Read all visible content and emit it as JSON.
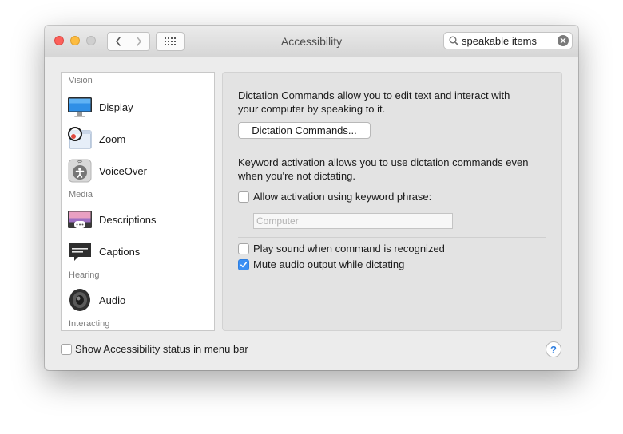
{
  "window": {
    "title": "Accessibility"
  },
  "toolbar": {
    "back_icon": "chevron-left-icon",
    "forward_icon": "chevron-right-icon",
    "show_all_icon": "grid-icon"
  },
  "search": {
    "value": "speakable items",
    "placeholder": "Search"
  },
  "sidebar": {
    "sections": {
      "vision": "Vision",
      "media": "Media",
      "hearing": "Hearing",
      "interacting": "Interacting"
    },
    "items": [
      {
        "label": "Display",
        "icon": "display-icon"
      },
      {
        "label": "Zoom",
        "icon": "zoom-icon"
      },
      {
        "label": "VoiceOver",
        "icon": "voiceover-icon"
      },
      {
        "label": "Descriptions",
        "icon": "descriptions-icon"
      },
      {
        "label": "Captions",
        "icon": "captions-icon"
      },
      {
        "label": "Audio",
        "icon": "audio-icon"
      }
    ]
  },
  "pane": {
    "intro_line1": "Dictation Commands allow you to edit text and interact with",
    "intro_line2": "your computer by speaking to it.",
    "dictation_button": "Dictation Commands...",
    "keyword_line1": "Keyword activation allows you to use dictation commands even",
    "keyword_line2": "when you're not dictating.",
    "allow_keyword_label": "Allow activation using keyword phrase:",
    "allow_keyword_checked": false,
    "keyword_placeholder": "Computer",
    "keyword_value": "",
    "play_sound_label": "Play sound when command is recognized",
    "play_sound_checked": false,
    "mute_audio_label": "Mute audio output while dictating",
    "mute_audio_checked": true
  },
  "footer": {
    "status_label": "Show Accessibility status in menu bar",
    "status_checked": false,
    "help_label": "?"
  },
  "colors": {
    "accent": "#3b8ff3",
    "close": "#fc605b",
    "minimize": "#fdbc40",
    "zoom_disabled": "#cfcfcf"
  }
}
